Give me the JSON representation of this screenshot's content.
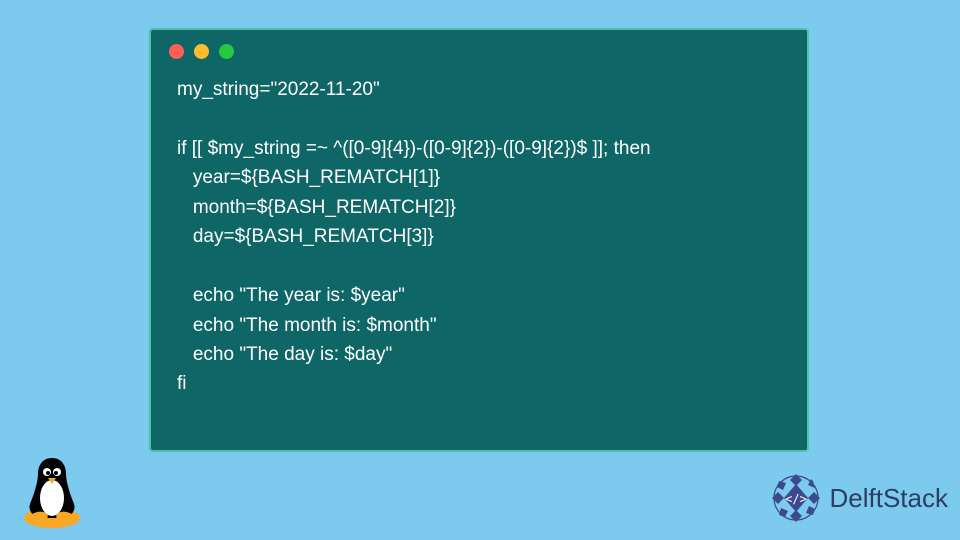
{
  "code": {
    "lines": [
      "my_string=\"2022-11-20\"",
      "",
      "if [[ $my_string =~ ^([0-9]{4})-([0-9]{2})-([0-9]{2})$ ]]; then",
      "   year=${BASH_REMATCH[1]}",
      "   month=${BASH_REMATCH[2]}",
      "   day=${BASH_REMATCH[3]}",
      "",
      "   echo \"The year is: $year\"",
      "   echo \"The month is: $month\"",
      "   echo \"The day is: $day\"",
      "fi"
    ]
  },
  "brand": {
    "name": "DelftStack"
  },
  "colors": {
    "page_bg": "#7ccaed",
    "window_bg": "#0f6666",
    "window_border": "#51c0aa",
    "code_text": "#ffffff",
    "brand_text": "#2c3e66",
    "brand_logo": "#3b4a8c"
  }
}
